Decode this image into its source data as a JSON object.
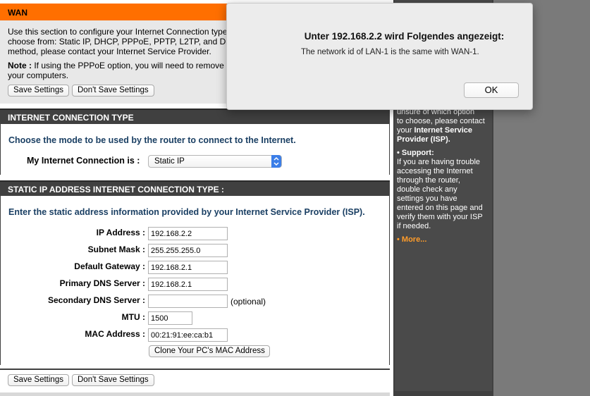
{
  "wan": {
    "title": "WAN",
    "lines": [
      "Use this section to configure your Internet Connection type",
      "choose from: Static IP, DHCP, PPPoE, PPTP, L2TP, and DS-L",
      "method, please contact your Internet Service Provider."
    ],
    "note_label": "Note :",
    "note_text": " If using the PPPoE option, you will need to remove",
    "note_line2": "your computers.",
    "save_label": "Save Settings",
    "dont_save_label": "Don't Save Settings"
  },
  "connection_type": {
    "header": "INTERNET CONNECTION TYPE",
    "intro": "Choose the mode to be used by the router to connect to the Internet.",
    "label": "My Internet Connection is :",
    "selected": "Static IP"
  },
  "static_ip": {
    "header": "STATIC IP ADDRESS INTERNET CONNECTION TYPE :",
    "intro": "Enter the static address information provided by your Internet Service Provider (ISP).",
    "fields": {
      "ip_label": "IP Address :",
      "ip_value": "192.168.2.2",
      "mask_label": "Subnet Mask :",
      "mask_value": "255.255.255.0",
      "gw_label": "Default Gateway :",
      "gw_value": "192.168.2.1",
      "dns1_label": "Primary DNS Server :",
      "dns1_value": "192.168.2.1",
      "dns2_label": "Secondary DNS Server :",
      "dns2_value": "",
      "dns2_hint": "(optional)",
      "mtu_label": "MTU :",
      "mtu_value": "1500",
      "mac_label": "MAC Address :",
      "mac_value": "00:21:91:ee:ca:b1"
    },
    "clone_label": "Clone Your PC's MAC Address"
  },
  "footer": {
    "save_label": "Save Settings",
    "dont_save_label": "Don't Save Settings"
  },
  "sidebar": {
    "l1": "unsure of which option",
    "l2": "to choose, please contact",
    "l3a": "your ",
    "l3b": "Internet Service",
    "l4": "Provider (ISP).",
    "support_label": "Support:",
    "s1": "If you are having trouble",
    "s2": "accessing the Internet",
    "s3": "through the router,",
    "s4": "double check any",
    "s5": "settings you have",
    "s6": "entered on this page and",
    "s7": "verify them with your ISP",
    "s8": "if needed.",
    "more": "More..."
  },
  "dialog": {
    "title": "Unter 192.168.2.2 wird Folgendes angezeigt:",
    "message": "The network id of LAN-1 is the same with WAN-1.",
    "ok": "OK"
  }
}
